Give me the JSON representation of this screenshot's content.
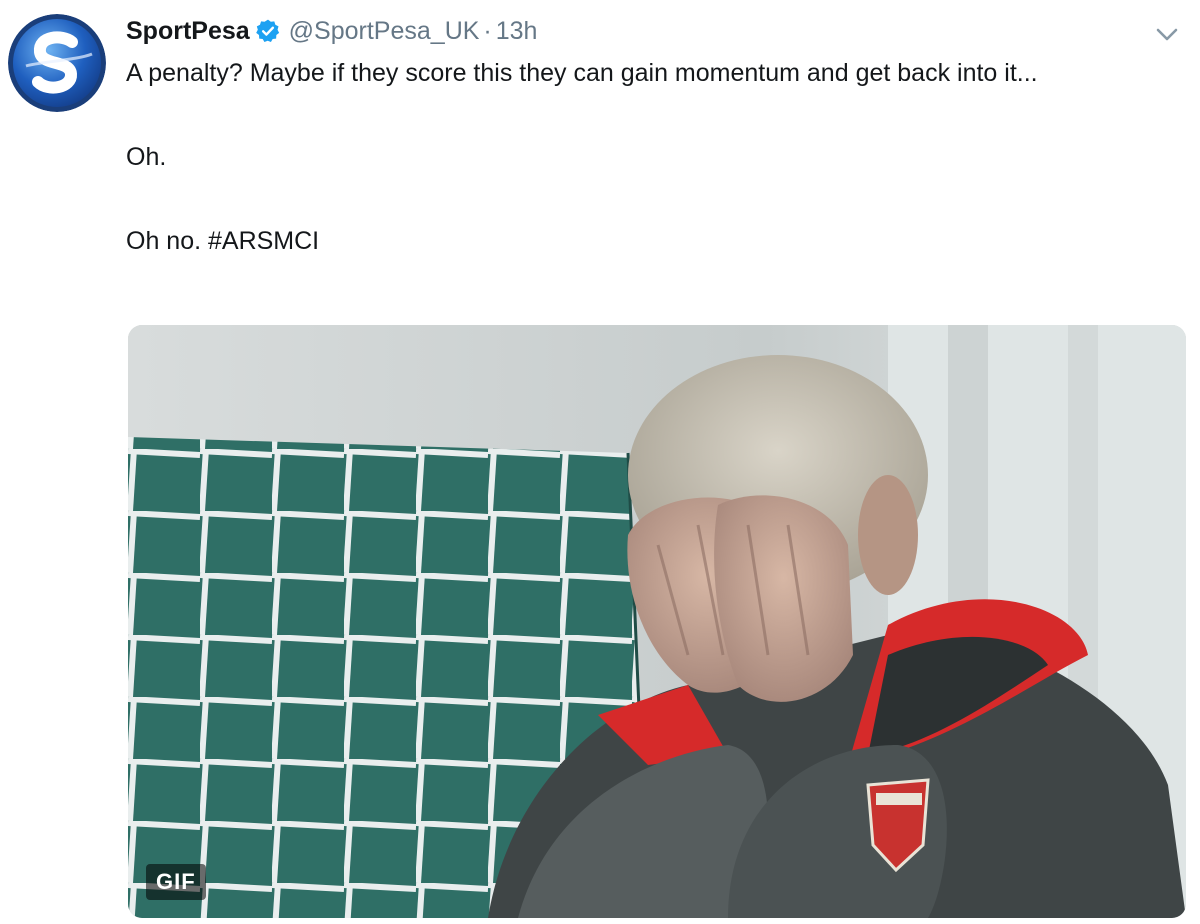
{
  "tweet": {
    "author": {
      "display_name": "SportPesa",
      "handle": "@SportPesa_UK",
      "verified": true,
      "avatar_icon": "sportpesa-logo-icon"
    },
    "separator": "·",
    "timestamp": "13h",
    "text_lines": [
      "A penalty? Maybe if they score this they can gain momentum and get back into it...",
      "Oh.",
      "Oh no. #ARSMCI"
    ],
    "media": {
      "type": "gif",
      "badge_label": "GIF"
    },
    "menu_icon": "chevron-down-icon"
  },
  "colors": {
    "text": "#14171a",
    "muted": "#657786",
    "verified_blue": "#1da1f2",
    "net_green": "#2f6f66",
    "jacket_red": "#d62a2a",
    "jacket_grey": "#3f4546"
  }
}
